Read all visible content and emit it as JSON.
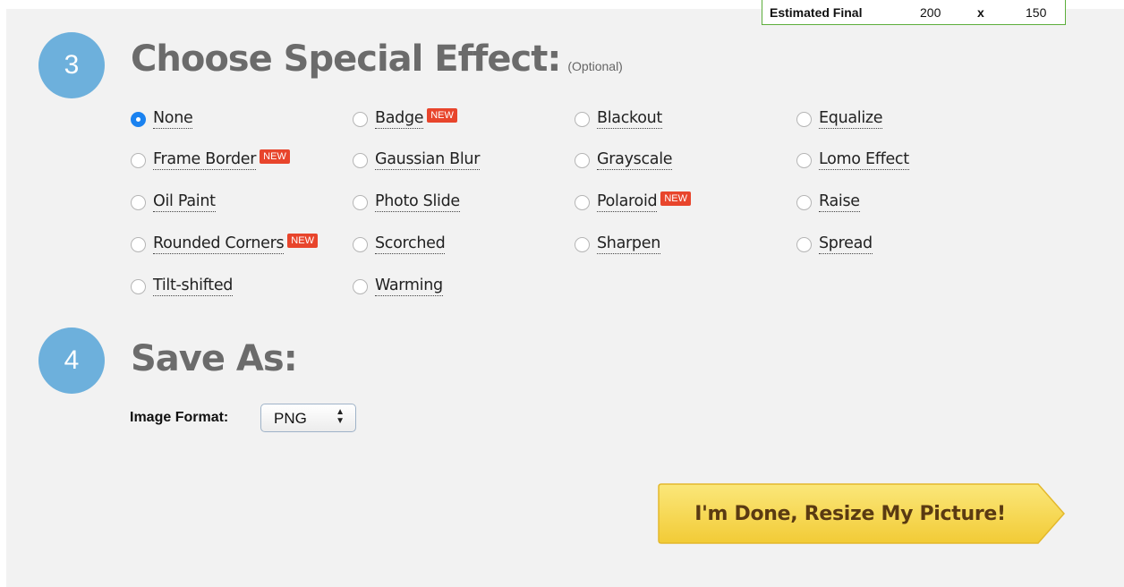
{
  "estimate": {
    "label": "Estimated Final",
    "width": "200",
    "sep": "x",
    "height": "150"
  },
  "step3": {
    "number": "3",
    "title": "Choose Special Effect:",
    "note": "(Optional)",
    "badge_text": "NEW",
    "effects": [
      {
        "label": "None",
        "checked": true,
        "new": false
      },
      {
        "label": "Badge",
        "checked": false,
        "new": true
      },
      {
        "label": "Blackout",
        "checked": false,
        "new": false
      },
      {
        "label": "Equalize",
        "checked": false,
        "new": false
      },
      {
        "label": "Frame Border",
        "checked": false,
        "new": true
      },
      {
        "label": "Gaussian Blur",
        "checked": false,
        "new": false
      },
      {
        "label": "Grayscale",
        "checked": false,
        "new": false
      },
      {
        "label": "Lomo Effect",
        "checked": false,
        "new": false
      },
      {
        "label": "Oil Paint",
        "checked": false,
        "new": false
      },
      {
        "label": "Photo Slide",
        "checked": false,
        "new": false
      },
      {
        "label": "Polaroid",
        "checked": false,
        "new": true
      },
      {
        "label": "Raise",
        "checked": false,
        "new": false
      },
      {
        "label": "Rounded Corners",
        "checked": false,
        "new": true
      },
      {
        "label": "Scorched",
        "checked": false,
        "new": false
      },
      {
        "label": "Sharpen",
        "checked": false,
        "new": false
      },
      {
        "label": "Spread",
        "checked": false,
        "new": false
      },
      {
        "label": "Tilt-shifted",
        "checked": false,
        "new": false
      },
      {
        "label": "Warming",
        "checked": false,
        "new": false
      }
    ]
  },
  "step4": {
    "number": "4",
    "title": "Save As:",
    "format_label": "Image Format:",
    "format_value": "PNG"
  },
  "submit": {
    "label": "I'm Done, Resize My Picture!"
  },
  "colors": {
    "step_circle": "#6db0dc",
    "new_badge": "#e8452c",
    "button": "#f6d54a",
    "radio_checked": "#1a82f0"
  }
}
